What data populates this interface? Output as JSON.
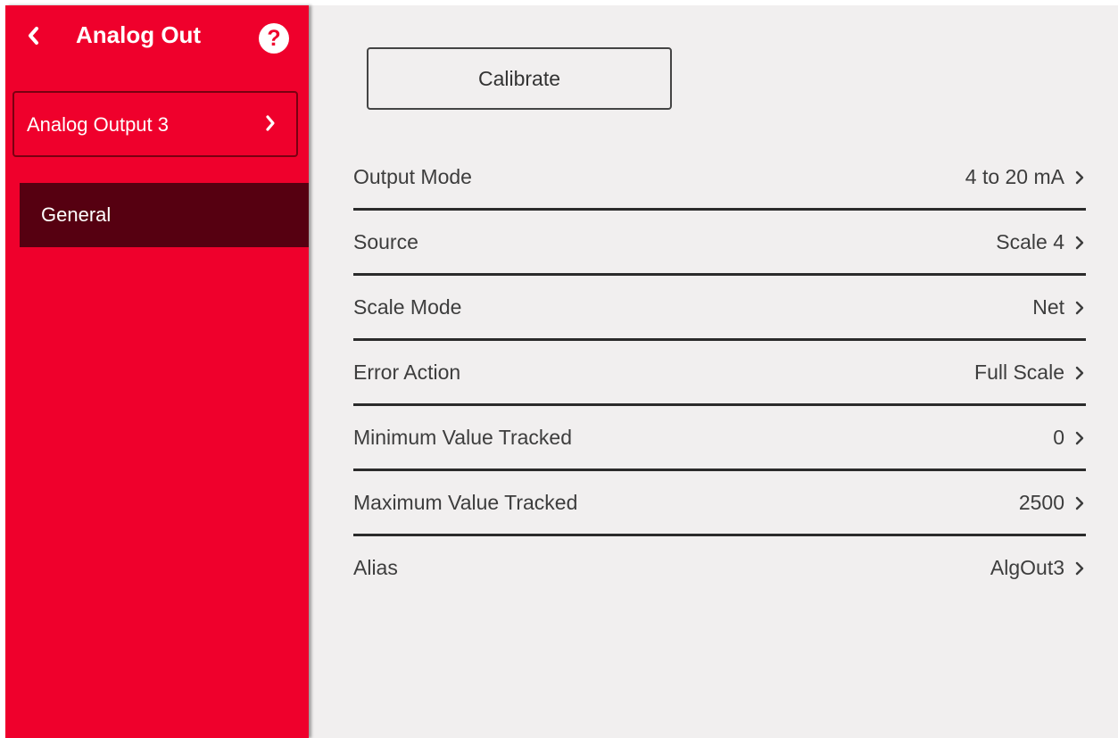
{
  "sidebar": {
    "title": "Analog Out",
    "help_glyph": "?",
    "section_label": "Analog Output 3",
    "subnav": [
      {
        "label": "General",
        "selected": true
      }
    ],
    "colors": {
      "background": "#ef002c",
      "selected_item": "#560011",
      "text": "#ffffff"
    }
  },
  "icons": {
    "back": "chevron-left-icon",
    "help": "help-circle-icon",
    "section": "chevron-right-icon",
    "row": "chevron-right-icon"
  },
  "main": {
    "calibrate_label": "Calibrate",
    "settings": [
      {
        "label": "Output Mode",
        "value": "4 to 20 mA"
      },
      {
        "label": "Source",
        "value": "Scale 4"
      },
      {
        "label": "Scale Mode",
        "value": "Net"
      },
      {
        "label": "Error Action",
        "value": "Full Scale"
      },
      {
        "label": "Minimum Value Tracked",
        "value": "0"
      },
      {
        "label": "Maximum Value Tracked",
        "value": "2500"
      },
      {
        "label": "Alias",
        "value": "AlgOut3"
      }
    ],
    "colors": {
      "background": "#f1efef",
      "text": "#3d3d3d",
      "divider": "#2b2b2b"
    }
  }
}
